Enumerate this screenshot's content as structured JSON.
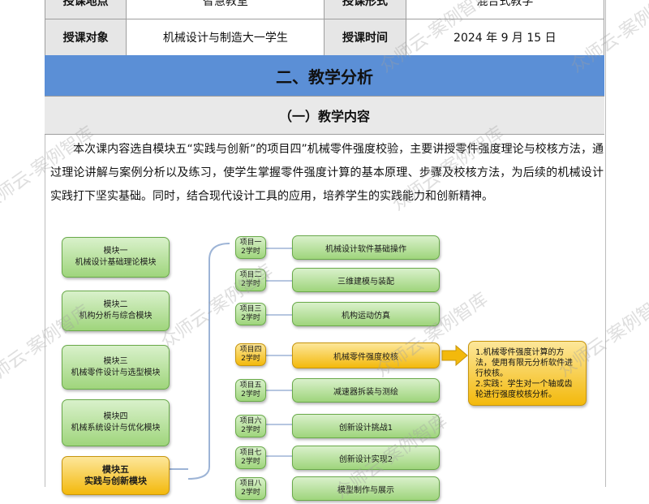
{
  "info_table": {
    "row0": {
      "label1": "授课地点",
      "value1": "智慧教室",
      "label2": "授课形式",
      "value2": "混合式教学"
    },
    "row1": {
      "label1": "授课对象",
      "value1": "机械设计与制造大一学生",
      "label2": "授课时间",
      "value2": "2024 年 9 月 15 日"
    }
  },
  "section_title": "二、教学分析",
  "subsection_title": "（一）教学内容",
  "paragraph": "本次课内容选自模块五“实践与创新”的项目四”机械零件强度校验，主要讲授零件强度理论与校核方法，通过理论讲解与案例分析以及练习，使学生掌握零件强度计算的基本原理、步骤及校核方法，为后续的机械设计实践打下坚实基础。同时，结合现代设计工具的应用，培养学生的实践能力和创新精神。",
  "diagram": {
    "modules": [
      {
        "l1": "模块一",
        "l2": "机械设计基础理论模块",
        "highlight": false
      },
      {
        "l1": "模块二",
        "l2": "机构分析与综合模块",
        "highlight": false
      },
      {
        "l1": "模块三",
        "l2": "机械零件设计与选型模块",
        "highlight": false
      },
      {
        "l1": "模块四",
        "l2": "机械系统设计与优化模块",
        "highlight": false
      },
      {
        "l1": "模块五",
        "l2": "实践与创新模块",
        "highlight": true
      }
    ],
    "projects": [
      {
        "name": "项目一",
        "hours": "2学时",
        "task": "机械设计软件基础操作",
        "highlight": false
      },
      {
        "name": "项目二",
        "hours": "2学时",
        "task": "三维建模与装配",
        "highlight": false
      },
      {
        "name": "项目三",
        "hours": "2学时",
        "task": "机构运动仿真",
        "highlight": false
      },
      {
        "name": "项目四",
        "hours": "2学时",
        "task": "机械零件强度校核",
        "highlight": true
      },
      {
        "name": "项目五",
        "hours": "2学时",
        "task": "减速器拆装与测绘",
        "highlight": false
      },
      {
        "name": "项目六",
        "hours": "2学时",
        "task": "创新设计挑战1",
        "highlight": false
      },
      {
        "name": "项目七",
        "hours": "2学时",
        "task": "创新设计实现2",
        "highlight": false
      },
      {
        "name": "项目八",
        "hours": "2学时",
        "task": "模型制作与展示",
        "highlight": false
      }
    ],
    "note_lines": [
      "1.机械零件强度计算的方法，使用有限元分析软件进行校核。",
      "2.实践：学生对一个轴或齿轮进行强度校核分析。"
    ]
  },
  "watermark": "众师云-案例智库",
  "colors": {
    "header_blue": "#5b8fd6",
    "green": "#9fd57c",
    "yellow": "#f3b90c"
  }
}
